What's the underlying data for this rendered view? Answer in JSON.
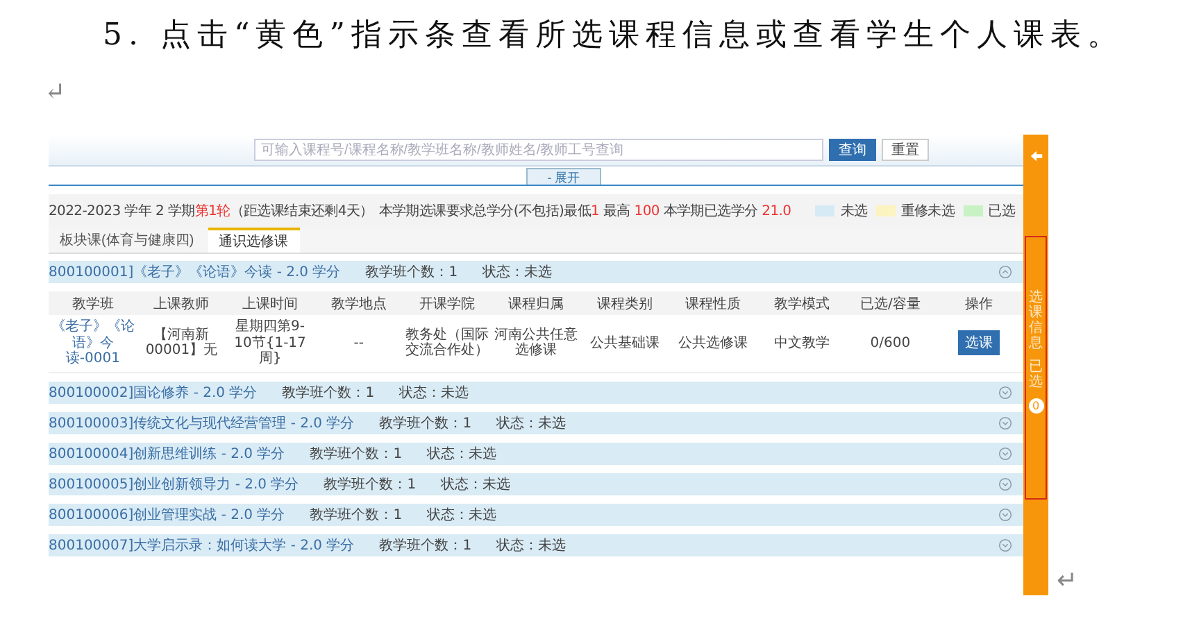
{
  "document": {
    "paragraph": "5. 点击“黄色”指示条查看所选课程信息或查看学生个人课表。",
    "paragraph_mark": "↵",
    "end_mark": "↵"
  },
  "screenshot": {
    "search": {
      "placeholder": "可输入课程号/课程名称/教学班名称/教师姓名/教师工号查询",
      "buttons": [
        {
          "label": "查询",
          "kind": "primary"
        },
        {
          "label": "重置",
          "kind": "plain"
        }
      ]
    },
    "toggle": "- 展开",
    "term": {
      "year": "2022-2023 学年 2 学期",
      "round": "第1轮",
      "countdown": "（距选课结束还剩4天）",
      "requirement": "本学期选课要求总学分(不包括)最低",
      "min": "1",
      "max_label": "最高",
      "max": "100",
      "earned_label": "本学期已选学分",
      "earned": "21.0"
    },
    "legend": [
      {
        "label": "未选",
        "color": "#d6eaf6"
      },
      {
        "label": "重修未选",
        "color": "#fbf3c0"
      },
      {
        "label": "已选",
        "color": "#c8f2c4"
      }
    ],
    "tabs": [
      {
        "label": "板块课(体育与健康四)",
        "selected": false
      },
      {
        "label": "通识选修课",
        "selected": true
      }
    ],
    "courses": [
      {
        "title": "800100001]《老子》《论语》今读 - 2.0 学分",
        "count": "教学班个数：1",
        "status": "状态：未选",
        "expanded": true,
        "columns": [
          "教学班",
          "上课教师",
          "上课时间",
          "教学地点",
          "开课学院",
          "课程归属",
          "课程类别",
          "课程性质",
          "教学模式",
          "已选/容量",
          "操作"
        ],
        "rows": [
          {
            "cells": [
              "《老子》《论语》今读-0001",
              "【河南新00001】无",
              "星期四第9-10节{1-17周}",
              "--",
              "教务处（国际交流合作处）",
              "河南公共任意选修课",
              "公共基础课",
              "公共选修课",
              "中文教学",
              "0/600"
            ],
            "action": "选课"
          }
        ]
      },
      {
        "title": "800100002]国论修养 - 2.0 学分",
        "count": "教学班个数：1",
        "status": "状态：未选",
        "expanded": false
      },
      {
        "title": "800100003]传统文化与现代经营管理 - 2.0 学分",
        "count": "教学班个数：1",
        "status": "状态：未选",
        "expanded": false
      },
      {
        "title": "800100004]创新思维训练 - 2.0 学分",
        "count": "教学班个数：1",
        "status": "状态：未选",
        "expanded": false
      },
      {
        "title": "800100005]创业创新领导力 - 2.0 学分",
        "count": "教学班个数：1",
        "status": "状态：未选",
        "expanded": false
      },
      {
        "title": "800100006]创业管理实战 - 2.0 学分",
        "count": "教学班个数：1",
        "status": "状态：未选",
        "expanded": false
      },
      {
        "title": "800100007]大学启示录：如何读大学 - 2.0 学分",
        "count": "教学班个数：1",
        "status": "状态：未选",
        "expanded": false
      }
    ],
    "sidebar": {
      "label": "选课信息",
      "selected_label": "已选",
      "count": "0",
      "highlighted": true
    }
  }
}
